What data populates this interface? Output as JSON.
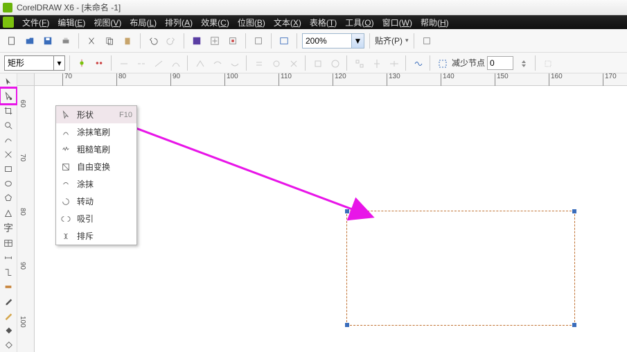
{
  "window": {
    "title": "CorelDRAW X6 - [未命名 -1]"
  },
  "menus": {
    "file": {
      "label": "文件",
      "hotkey": "F"
    },
    "edit": {
      "label": "编辑",
      "hotkey": "E"
    },
    "view": {
      "label": "视图",
      "hotkey": "V"
    },
    "layout": {
      "label": "布局",
      "hotkey": "L"
    },
    "arrange": {
      "label": "排列",
      "hotkey": "A"
    },
    "effect": {
      "label": "效果",
      "hotkey": "C"
    },
    "bitmap": {
      "label": "位图",
      "hotkey": "B"
    },
    "text": {
      "label": "文本",
      "hotkey": "X"
    },
    "table": {
      "label": "表格",
      "hotkey": "T"
    },
    "tools": {
      "label": "工具",
      "hotkey": "O"
    },
    "window": {
      "label": "窗口",
      "hotkey": "W"
    },
    "help": {
      "label": "帮助",
      "hotkey": "H"
    }
  },
  "toolbar": {
    "zoom_value": "200%",
    "snap_label": "贴齐(P)"
  },
  "propbar": {
    "shape_type": "矩形",
    "reduce_label": "减少节点",
    "reduce_value": "0"
  },
  "ruler_ticks": [
    "70",
    "80",
    "90",
    "100",
    "110",
    "120",
    "130",
    "140",
    "150",
    "160",
    "170"
  ],
  "ruler_v_ticks": [
    "60",
    "70",
    "80",
    "90",
    "100"
  ],
  "flyout": {
    "items": [
      {
        "icon": "shape-icon",
        "label": "形状",
        "shortcut": "F10"
      },
      {
        "icon": "smudge-icon",
        "label": "涂抹笔刷",
        "shortcut": ""
      },
      {
        "icon": "rough-icon",
        "label": "粗糙笔刷",
        "shortcut": ""
      },
      {
        "icon": "freetransform-icon",
        "label": "自由变换",
        "shortcut": ""
      },
      {
        "icon": "smear-icon",
        "label": "涂抹",
        "shortcut": ""
      },
      {
        "icon": "twirl-icon",
        "label": "转动",
        "shortcut": ""
      },
      {
        "icon": "attract-icon",
        "label": "吸引",
        "shortcut": ""
      },
      {
        "icon": "repel-icon",
        "label": "排斥",
        "shortcut": ""
      }
    ]
  },
  "colors": {
    "annotation": "#e815e8",
    "ruler": "#555555"
  }
}
